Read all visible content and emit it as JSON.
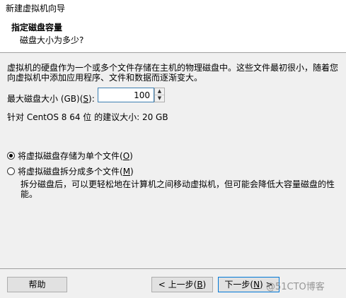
{
  "window": {
    "title": "新建虚拟机向导"
  },
  "header": {
    "heading": "指定磁盘容量",
    "subheading": "磁盘大小为多少?"
  },
  "body": {
    "description": "虚拟机的硬盘作为一个或多个文件存储在主机的物理磁盘中。这些文件最初很小，随着您向虚拟机中添加应用程序、文件和数据而逐渐变大。",
    "max_size_label_pre": "最大磁盘大小 (GB)(",
    "max_size_label_key": "S",
    "max_size_label_post": "):",
    "max_size_value": "100",
    "recommended": "针对 CentOS 8 64 位 的建议大小: 20 GB"
  },
  "options": {
    "single_label_pre": "将虚拟磁盘存储为单个文件(",
    "single_label_key": "O",
    "single_label_post": ")",
    "single_checked": true,
    "split_label_pre": "将虚拟磁盘拆分成多个文件(",
    "split_label_key": "M",
    "split_label_post": ")",
    "split_checked": false,
    "split_description": "拆分磁盘后，可以更轻松地在计算机之间移动虚拟机，但可能会降低大容量磁盘的性能。"
  },
  "footer": {
    "help_label": "帮助",
    "prev_pre": "< 上一步(",
    "prev_key": "B",
    "prev_post": ")",
    "next_pre": "下一步(",
    "next_key": "N",
    "next_post": ") >"
  },
  "watermark": "@51CTO博客"
}
